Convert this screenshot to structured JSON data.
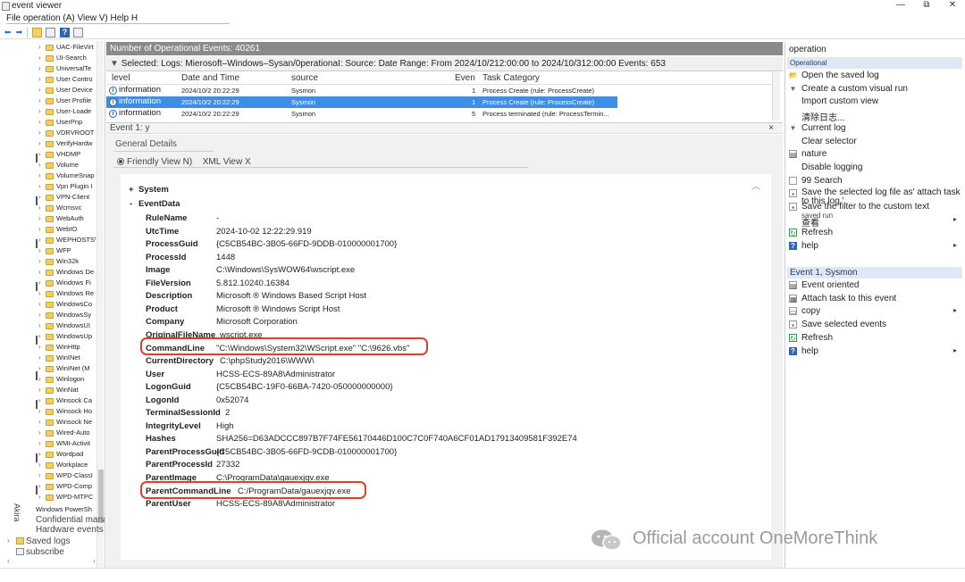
{
  "window": {
    "title": "event viewer",
    "controls": [
      "—",
      "⧉",
      "✕"
    ]
  },
  "menu": {
    "text": "File operation (A) View V) Help H"
  },
  "tree": {
    "items": [
      "UAC-FileVirt",
      "UI-Search",
      "UniversalTe",
      "User Contro",
      "User Device",
      "User Profile",
      "User-Loade",
      "UserPnp",
      "VDRVROOT",
      "VerifyHardw",
      "VHDMP",
      "Volume",
      "VolumeSnap",
      "Vpn Plugin I",
      "VPN-Client",
      "Wcmsvc",
      "WebAuth",
      "WebIO",
      "WEPHOSTS\\",
      "WFP",
      "Win32k",
      "Windows De",
      "Windows Fi",
      "Windows Re",
      "WindowsCo",
      "WindowsSy",
      "WindowsUI",
      "WindowsUp",
      "WinHttp",
      "WinINet",
      "WinINet (M",
      "Winlogon",
      "WinNat",
      "Winsock Ca",
      "Winsock Ho",
      "Winsock Ne",
      "Wired-Auto",
      "WMI-Activit",
      "Wordpad",
      "Workplace",
      "WPD-ClassI",
      "WPD-Comp",
      "WPD-MTPC"
    ],
    "powershell": "Windows PowerSh",
    "akira": "Akira",
    "confidential": "Confidential management service",
    "hardware": "Hardware events",
    "saved_logs": "Saved logs",
    "subscribe": "subscribe"
  },
  "header": {
    "title": "Number of Operational Events: 40261",
    "filter": "Selected: Logs: Mierosoft–Windows–Sysan/0perationaI: Source: Date Range: From 2024/10/212:00:00 to 2024/10/312:00:00 Events: 653"
  },
  "table": {
    "columns": [
      "level",
      "Date and Time",
      "source",
      "Even",
      "Task Category"
    ],
    "rows": [
      {
        "level": "information",
        "datetime": "2024/10/2 20:22:29",
        "source": "Sysmon",
        "event": "1",
        "category": "Process Create (rule: ProcessCreate)"
      },
      {
        "level": "information",
        "datetime": "2024/10/2 20:22:29",
        "source": "Sysmon",
        "event": "1",
        "category": "Process Create (rule: ProcessCreate)"
      },
      {
        "level": "information",
        "datetime": "2024/10/2 20:22:29",
        "source": "Sysmon",
        "event": "5",
        "category": "Process terminated (rule: ProcessTermin..."
      }
    ]
  },
  "event_pane": {
    "title": "Event 1: y",
    "close": "×",
    "tab_general": "General Details",
    "tab_friendly": "Friendly View N)",
    "tab_xml": "XML View X",
    "system_label": "System",
    "eventdata_label": "EventData",
    "fields": [
      {
        "key": "RuleName",
        "value": "-"
      },
      {
        "key": "UtcTime",
        "value": "2024-10-02 12:22:29.919"
      },
      {
        "key": "ProcessGuid",
        "value": "{C5CB54BC-3B05-66FD-9DDB-010000001700}"
      },
      {
        "key": "ProcessId",
        "value": "1448"
      },
      {
        "key": "Image",
        "value": "C:\\Windows\\SysWOW64\\wscript.exe"
      },
      {
        "key": "FileVersion",
        "value": "5.812.10240.16384"
      },
      {
        "key": "Description",
        "value": "Microsoft ® Windows Based Script Host"
      },
      {
        "key": "Product",
        "value": "Microsoft ® Windows Script Host"
      },
      {
        "key": "Company",
        "value": "Microsoft Corporation"
      },
      {
        "key": "OriginalFileName",
        "value": "wscript.exe"
      },
      {
        "key": "CommandLine",
        "value": "\"C:\\Windows\\System32\\WScript.exe\" \"C:\\9626.vbs\""
      },
      {
        "key": "CurrentDirectory",
        "value": "C:\\phpStudy2016\\WWW\\"
      },
      {
        "key": "User",
        "value": "HCSS-ECS-89A8\\Administrator"
      },
      {
        "key": "LogonGuid",
        "value": "{C5CB54BC-19F0-66BA-7420-050000000000}"
      },
      {
        "key": "LogonId",
        "value": "0x52074"
      },
      {
        "key": "TerminalSessionId",
        "value": "2"
      },
      {
        "key": "IntegrityLevel",
        "value": "High"
      },
      {
        "key": "Hashes",
        "value": "SHA256=D63ADCCC897B7F74FE56170446D100C7C0F740A6CF01AD17913409581F392E74"
      },
      {
        "key": "ParentProcessGuid",
        "value": "{C5CB54BC-3B05-66FD-9CDB-010000001700}"
      },
      {
        "key": "ParentProcessId",
        "value": "27332"
      },
      {
        "key": "ParentImage",
        "value": "C:\\ProgramData\\gauexjqv.exe"
      },
      {
        "key": "ParentCommandLine",
        "value": "C:/ProgramData/gauexjqv.exe"
      },
      {
        "key": "ParentUser",
        "value": "HCSS-ECS-89A8\\Administrator"
      }
    ]
  },
  "actions": {
    "title": "operation",
    "section1": "Operational",
    "items1": [
      {
        "icon": "open-log-icon",
        "glyph": "📂",
        "label": "Open the saved log"
      },
      {
        "icon": "filter-icon",
        "glyph": "▼",
        "label": "Create a custom visual run"
      },
      {
        "icon": "",
        "glyph": "",
        "label": "Import custom view"
      },
      {
        "icon": "",
        "glyph": "",
        "label": "清除日志..."
      },
      {
        "icon": "filter-icon",
        "glyph": "▼",
        "label": "Current log"
      },
      {
        "icon": "",
        "glyph": "",
        "label": "Clear selector"
      },
      {
        "icon": "properties-icon",
        "glyph": "▤",
        "label": "nature"
      },
      {
        "icon": "",
        "glyph": "",
        "label": "Disable logging"
      },
      {
        "icon": "find-icon",
        "glyph": "",
        "label": "99 Search"
      },
      {
        "icon": "save-icon",
        "glyph": "▪",
        "label": "Save the selected log file as' attach task to this log '"
      },
      {
        "icon": "save-filter-icon",
        "glyph": "▪",
        "label": "Save the filter to the custom text"
      },
      {
        "icon": "",
        "glyph": "",
        "label": "查看"
      },
      {
        "icon": "refresh-icon",
        "glyph": "↻",
        "label": "Refresh"
      },
      {
        "icon": "help-icon",
        "glyph": "?",
        "label": "help"
      }
    ],
    "section2": "Event 1, Sysmon",
    "items2": [
      {
        "icon": "event-properties-icon",
        "glyph": "▤",
        "label": "Event oriented"
      },
      {
        "icon": "attach-task-icon",
        "glyph": "▦",
        "label": "Attach task to this event"
      },
      {
        "icon": "copy-icon",
        "glyph": "▭",
        "label": "copy"
      },
      {
        "icon": "save-icon",
        "glyph": "▪",
        "label": "Save selected events"
      },
      {
        "icon": "refresh-icon",
        "glyph": "↻",
        "label": "Refresh"
      },
      {
        "icon": "help-icon",
        "glyph": "?",
        "label": "help"
      }
    ],
    "extra_overlay": "saved run"
  },
  "watermark": {
    "text": "Official account OneMoreThink"
  },
  "colors": {
    "selection": "#3d8ee7",
    "highlight": "#d9432b",
    "header_bar": "#8a8a8a",
    "section_bg": "#dfe8f4"
  }
}
